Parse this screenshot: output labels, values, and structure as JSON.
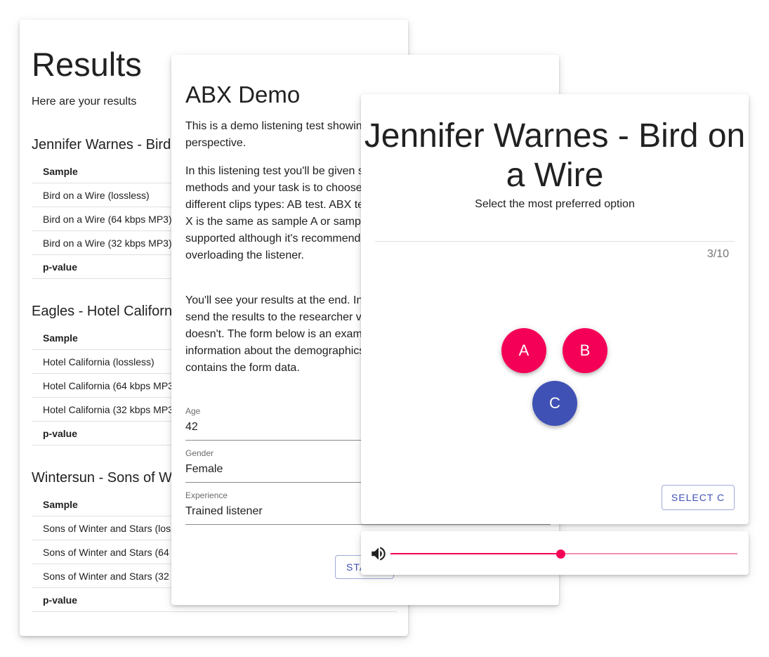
{
  "results": {
    "title": "Results",
    "subtitle": "Here are your results",
    "column_header": "Sample",
    "tests": [
      {
        "name": "Jennifer Warnes - Bird on a Wire",
        "rows": [
          "Bird on a Wire (lossless)",
          "Bird on a Wire (64 kbps MP3)",
          "Bird on a Wire (32 kbps MP3)"
        ],
        "pvalue_label": "p-value"
      },
      {
        "name": "Eagles - Hotel California",
        "rows": [
          "Hotel California (lossless)",
          "Hotel California (64 kbps MP3)",
          "Hotel California (32 kbps MP3)"
        ],
        "pvalue_label": "p-value"
      },
      {
        "name": "Wintersun - Sons of Winter and Stars",
        "rows": [
          "Sons of Winter and Stars (lossless)",
          "Sons of Winter and Stars (64 kbps MP3)",
          "Sons of Winter and Stars (32 kbps MP3)"
        ],
        "pvalue_label": "p-value"
      }
    ]
  },
  "abx": {
    "title": "ABX Demo",
    "paragraphs": [
      "This is a demo listening test showing how it works from the listener's perspective.",
      "In this listening test you'll be given samples of different compression methods and your task is to choose the best option. There are two different clips types: AB test. ABX tests where the listener picks whether X is the same as sample A or sample B. Greater than 2 options are supported although it's recommended to keep the number low to avoid overloading the listener.",
      "You'll see your results at the end. In a real test you can have the test send the results to the researcher via the configuration file but this test doesn't. The form below is an example of what can be done to gather information about the demographics. The email sent to the researcher contains the form data."
    ],
    "fields": [
      {
        "label": "Age",
        "value": "42"
      },
      {
        "label": "Gender",
        "value": "Female"
      },
      {
        "label": "Experience",
        "value": "Trained listener"
      }
    ],
    "start_label": "START"
  },
  "question": {
    "title": "Jennifer Warnes - Bird on a Wire",
    "subtitle": "Select the most preferred option",
    "progress": "3/10",
    "options": [
      "A",
      "B",
      "C"
    ],
    "selected_option": "C",
    "select_label": "SELECT C"
  },
  "player": {
    "volume_icon": "volume-up-icon",
    "position": 0.49
  },
  "colors": {
    "accent_pink": "#f50057",
    "primary_blue": "#3f51b5"
  }
}
